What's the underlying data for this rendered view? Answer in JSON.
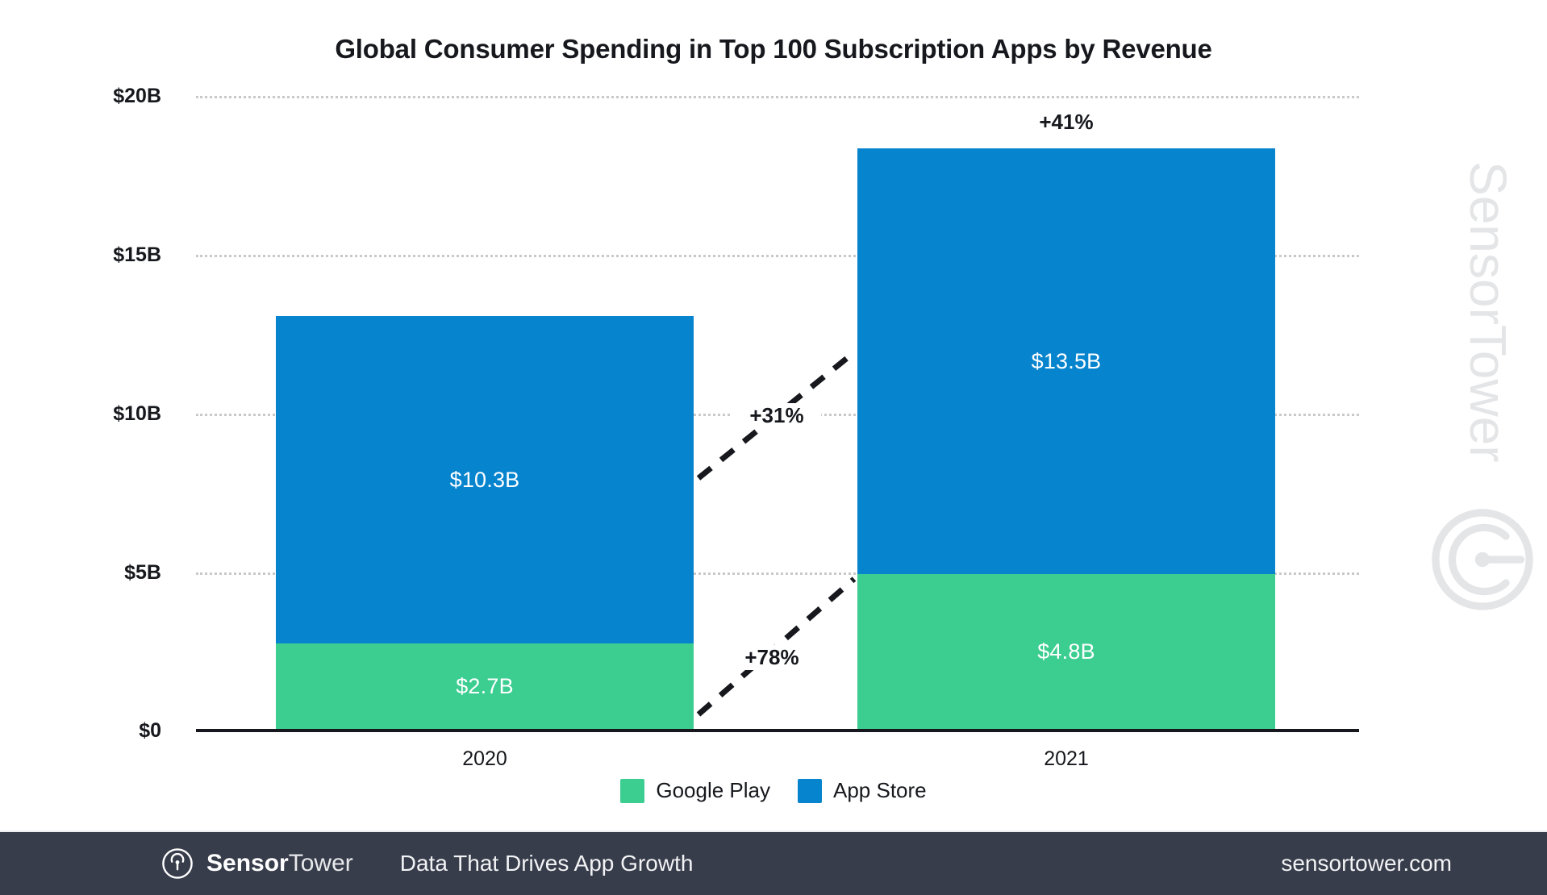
{
  "chart_data": {
    "type": "bar",
    "subtype": "stacked-bar",
    "title": "Global Consumer Spending in Top 100 Subscription Apps by Revenue",
    "xlabel": "",
    "ylabel": "",
    "categories": [
      "2020",
      "2021"
    ],
    "ylim": [
      0,
      20
    ],
    "y_ticks": [
      0,
      5,
      10,
      15,
      20
    ],
    "y_tick_labels": [
      "$0",
      "$5B",
      "$10B",
      "$15B",
      "$20B"
    ],
    "grid": true,
    "grid_style": "dotted-horizontal",
    "legend_position": "bottom-center",
    "series": [
      {
        "name": "Google Play",
        "color": "#3ccd90",
        "values": [
          2.7,
          4.8
        ],
        "value_labels": [
          "$2.7B",
          "$4.8B"
        ],
        "growth_label": "+78%"
      },
      {
        "name": "App Store",
        "color": "#0784ce",
        "values": [
          10.3,
          13.5
        ],
        "value_labels": [
          "$10.3B",
          "$13.5B"
        ],
        "growth_label": "+31%"
      }
    ],
    "totals": [
      13.0,
      18.3
    ],
    "annotations": [
      {
        "id": "total-growth",
        "text": "+41%",
        "position": "above-2021-bar"
      },
      {
        "id": "appstore-growth",
        "text": "+31%",
        "position": "between-appstore-segments"
      },
      {
        "id": "googleplay-growth",
        "text": "+78%",
        "position": "between-googleplay-segments"
      }
    ]
  },
  "axis": {
    "y_labels": [
      "$20B",
      "$15B",
      "$10B",
      "$5B",
      "$0"
    ],
    "x_labels": [
      "2020",
      "2021"
    ]
  },
  "legend": {
    "items": [
      {
        "label": "Google Play",
        "color": "#3ccd90"
      },
      {
        "label": "App Store",
        "color": "#0784ce"
      }
    ]
  },
  "watermark": {
    "brand_light": "Sensor",
    "brand_bold": "Tower",
    "full": "SensorTower",
    "color": "#e4e5e7"
  },
  "footer": {
    "brand_bold": "Sensor",
    "brand_light": "Tower",
    "tagline": "Data That Drives App Growth",
    "url": "sensortower.com",
    "background": "#383d4b"
  },
  "colors": {
    "google_play": "#3ccd90",
    "app_store": "#0784ce",
    "text": "#16181d",
    "grid": "#c9c9c9",
    "footer_bg": "#383d4b"
  }
}
